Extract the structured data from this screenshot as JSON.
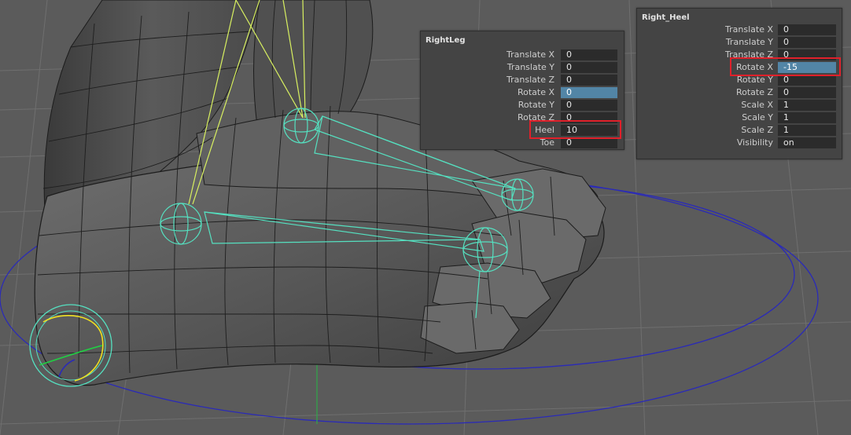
{
  "panels": {
    "right_leg": {
      "title": "RightLeg",
      "rows": [
        {
          "label": "Translate X",
          "value": "0"
        },
        {
          "label": "Translate Y",
          "value": "0"
        },
        {
          "label": "Translate Z",
          "value": "0"
        },
        {
          "label": "Rotate X",
          "value": "0"
        },
        {
          "label": "Rotate Y",
          "value": "0"
        },
        {
          "label": "Rotate Z",
          "value": "0"
        },
        {
          "label": "Heel",
          "value": "10"
        },
        {
          "label": "Toe",
          "value": "0"
        }
      ]
    },
    "right_heel": {
      "title": "Right_Heel",
      "rows": [
        {
          "label": "Translate X",
          "value": "0"
        },
        {
          "label": "Translate Y",
          "value": "0"
        },
        {
          "label": "Translate Z",
          "value": "0"
        },
        {
          "label": "Rotate X",
          "value": "-15"
        },
        {
          "label": "Rotate Y",
          "value": "0"
        },
        {
          "label": "Rotate Z",
          "value": "0"
        },
        {
          "label": "Scale X",
          "value": "1"
        },
        {
          "label": "Scale Y",
          "value": "1"
        },
        {
          "label": "Scale Z",
          "value": "1"
        },
        {
          "label": "Visibility",
          "value": "on"
        }
      ]
    }
  },
  "colors": {
    "highlight": "#e0202a",
    "selected_field": "#5285a6",
    "joint": "#55e0c0",
    "ik_handle": "#d8f060",
    "control_curve": "#2a2ab8"
  }
}
